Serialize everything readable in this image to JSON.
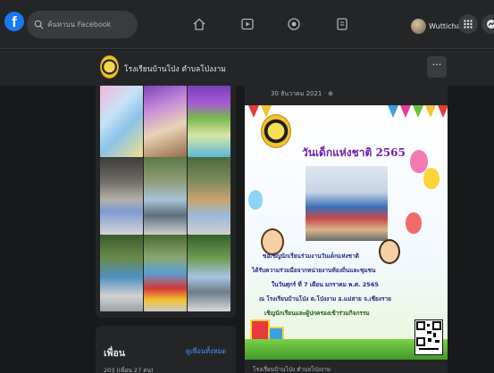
{
  "topbar": {
    "logo": "f",
    "search_placeholder": "ค้นหาบน Facebook",
    "nav_icons": [
      "home-icon",
      "video-icon",
      "groups-icon",
      "pages-icon"
    ],
    "profile_name": "Wuttichai",
    "menu_icon": "grid-menu-icon",
    "messenger_icon": "messenger-icon"
  },
  "page_header": {
    "name": "โรงเรียนบ้านโป่ง ตำบลโป่งงาม",
    "more_label": "···"
  },
  "friends": {
    "title": "เพื่อน",
    "see_all": "ดูเพื่อนทั้งหมด",
    "count": "203 (เพื่อน 27 คน)"
  },
  "post": {
    "date": "30 ธันวาคม 2021 · ⊕",
    "image_title": "วันเด็กแห่งชาติ 2565",
    "image_lines": [
      "ขอเชิญนักเรียนร่วมงานวันเด็กแห่งชาติ",
      "ได้รับความร่วมมือจากหน่วยงานท้องถิ่นและชุมชน",
      "ในวันศุกร์ ที่ 7 เดือน มกราคม พ.ศ. 2565",
      "ณ โรงเรียนบ้านโป่ง ต.โป่งงาม อ.แม่สาย จ.เชียงราย",
      "เชิญนักเรียนและผู้ปกครองเข้าร่วมกิจกรรม"
    ],
    "footer": "โรงเรียนบ้านโป่ง ตำบลโป่งงาม"
  },
  "colors": {
    "bg": "#18191a",
    "card": "#242526",
    "accent": "#1877f2",
    "link": "#4599ff"
  }
}
